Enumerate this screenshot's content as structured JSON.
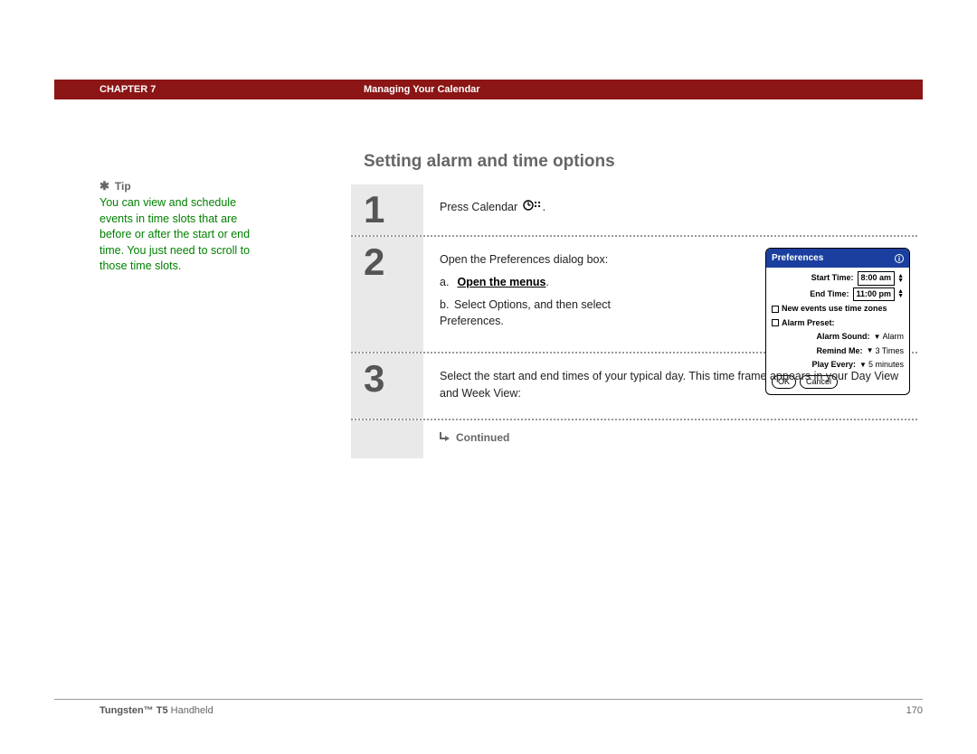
{
  "header": {
    "chapter_label": "CHAPTER 7",
    "chapter_title": "Managing Your Calendar"
  },
  "section_title": "Setting alarm and time options",
  "tip": {
    "label": "Tip",
    "body": "You can view and schedule events in time slots that are before or after the start or end time. You just need to scroll to those time slots."
  },
  "steps": [
    {
      "num": "1",
      "text_pre": "Press Calendar ",
      "text_post": "."
    },
    {
      "num": "2",
      "intro": "Open the Preferences dialog box:",
      "sub_a_letter": "a.",
      "sub_a_text": "Open the menus",
      "sub_a_tail": ".",
      "sub_b_letter": "b.",
      "sub_b_text": "Select Options, and then select Preferences."
    },
    {
      "num": "3",
      "text": "Select the start and end times of your typical day. This time frame appears in your Day View and Week View:"
    }
  ],
  "continued_label": "Continued",
  "prefs": {
    "title": "Preferences",
    "start_label": "Start Time:",
    "start_val": "8:00 am",
    "end_label": "End Time:",
    "end_val": "11:00 pm",
    "tz_label": "New events use time zones",
    "preset_label": "Alarm Preset:",
    "sound_label": "Alarm Sound:",
    "sound_val": "Alarm",
    "remind_label": "Remind Me:",
    "remind_val": "3 Times",
    "play_label": "Play Every:",
    "play_val": "5 minutes",
    "ok": "OK",
    "cancel": "Cancel"
  },
  "footer": {
    "product_bold": "Tungsten™ T5",
    "product_rest": " Handheld",
    "page_num": "170"
  }
}
